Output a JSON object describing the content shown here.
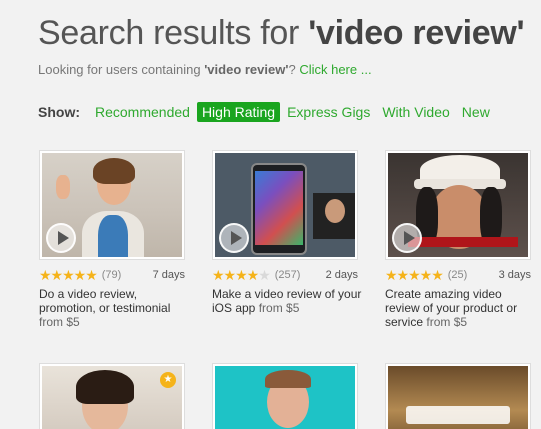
{
  "header": {
    "title_prefix": "Search results for ",
    "title_query": "'video review'",
    "subtitle_prefix": "Looking for users containing ",
    "subtitle_query": "'video review'",
    "subtitle_q_mark": "?",
    "subtitle_link": "Click here ..."
  },
  "filters": {
    "show_label": "Show:",
    "items": [
      {
        "label": "Recommended",
        "active": false
      },
      {
        "label": "High Rating",
        "active": true
      },
      {
        "label": "Express Gigs",
        "active": false
      },
      {
        "label": "With Video",
        "active": false
      },
      {
        "label": "New",
        "active": false
      }
    ]
  },
  "gigs": [
    {
      "rating": 5,
      "reviews": "(79)",
      "days": "7 days",
      "title": "Do a video review, promotion, or testimonial",
      "price": "from $5",
      "has_video": true
    },
    {
      "rating": 4.5,
      "reviews": "(257)",
      "days": "2 days",
      "title": "Make a video review of your iOS app",
      "price": "from $5",
      "has_video": true
    },
    {
      "rating": 5,
      "reviews": "(25)",
      "days": "3 days",
      "title": "Create amazing video review of your product or service",
      "price": "from $5",
      "has_video": true
    },
    {
      "has_video": false
    },
    {
      "has_video": false
    },
    {
      "has_video": false
    }
  ],
  "icons": {
    "star": "★",
    "badge": "★"
  },
  "colors": {
    "accent_green": "#2fa92f",
    "active_filter_bg": "#1aa51f",
    "star": "#f5b31a"
  }
}
